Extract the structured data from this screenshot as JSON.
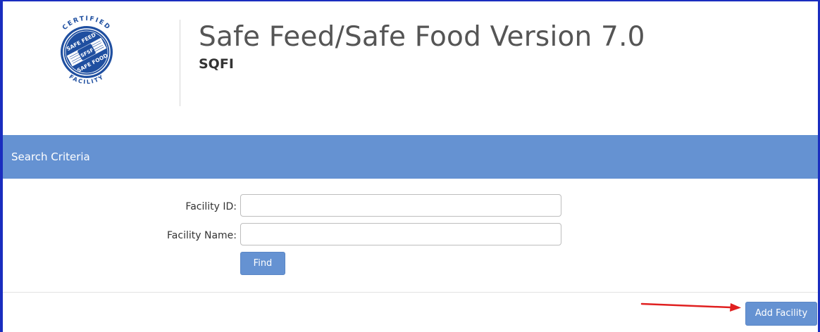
{
  "app": {
    "title": "Safe Feed/Safe Food Version 7.0",
    "subtitle": "SQFI"
  },
  "logo": {
    "text_top": "CERTIFIED",
    "text_upper": "SAFE FEED",
    "text_center": "SFSF",
    "text_lower": "SAFE FOOD",
    "text_bottom": "FACILITY"
  },
  "search": {
    "heading": "Search Criteria",
    "facility_id_label": "Facility ID:",
    "facility_id_value": "",
    "facility_name_label": "Facility Name:",
    "facility_name_value": "",
    "find_label": "Find"
  },
  "actions": {
    "add_facility_label": "Add Facility"
  },
  "colors": {
    "accent": "#6592d2",
    "window_border": "#1a2dbf",
    "logo_blue": "#1f4fa0",
    "annotation_arrow": "#e02020"
  },
  "icons": {
    "annotation": "red-arrow-icon"
  }
}
